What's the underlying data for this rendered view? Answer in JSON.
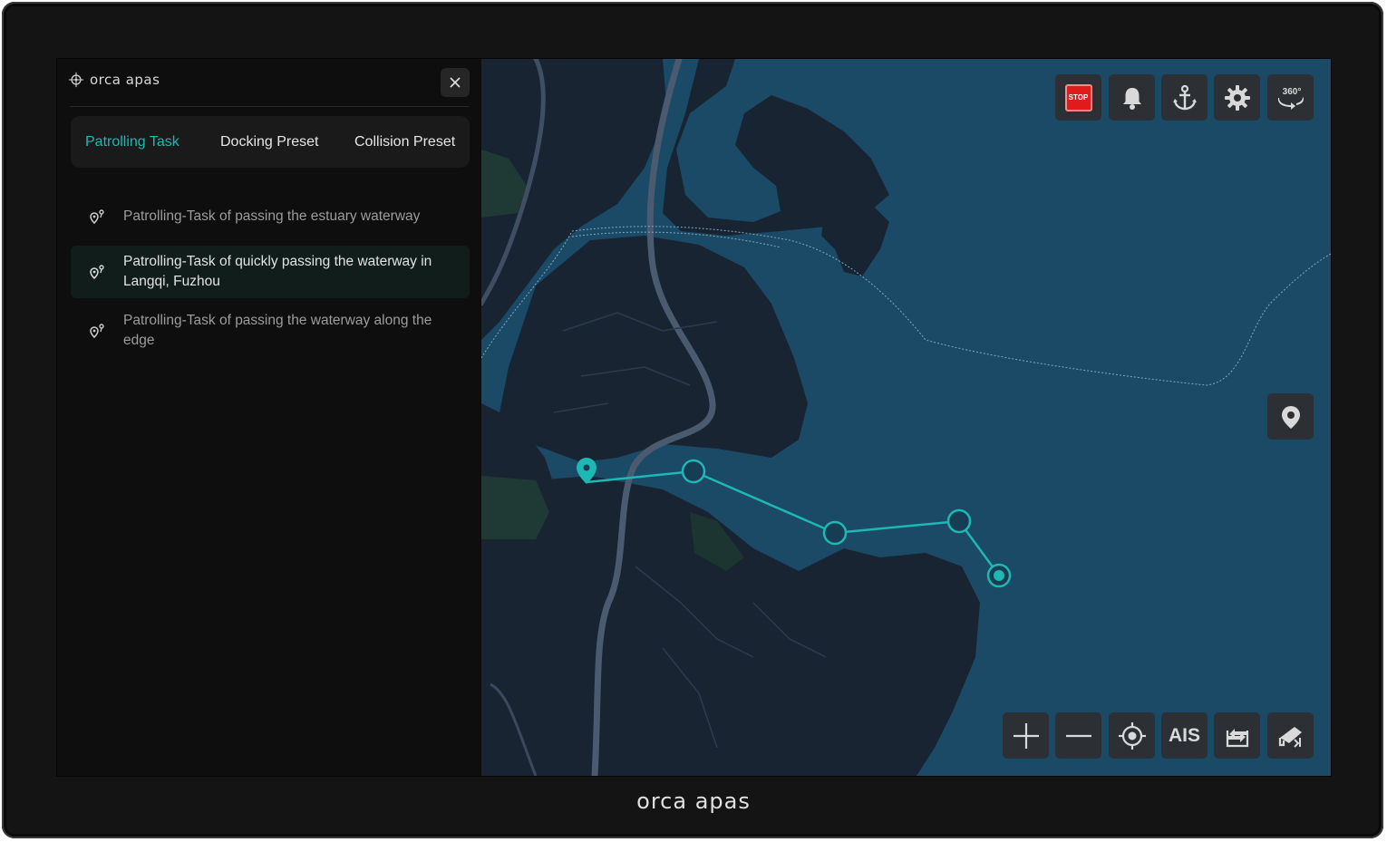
{
  "app": {
    "brand_small": "orca apas",
    "brand_footer": "orca apas"
  },
  "panel": {
    "close_icon": "close-icon",
    "tabs": [
      {
        "label": "Patrolling Task",
        "active": true
      },
      {
        "label": "Docking Preset",
        "active": false
      },
      {
        "label": "Collision Preset",
        "active": false
      }
    ],
    "tasks": [
      {
        "label": "Patrolling-Task of passing the estuary waterway",
        "selected": false,
        "icon": "route-pin-icon"
      },
      {
        "label": "Patrolling-Task of quickly passing the waterway in Langqi, Fuzhou",
        "selected": true,
        "icon": "route-pin-icon"
      },
      {
        "label": "Patrolling-Task of passing the waterway along the edge",
        "selected": false,
        "icon": "route-pin-icon"
      }
    ]
  },
  "map": {
    "top_controls": [
      {
        "name": "stop-button",
        "label": "STOP",
        "icon": "stop-icon"
      },
      {
        "name": "alarm-button",
        "icon": "bell-icon"
      },
      {
        "name": "anchor-button",
        "icon": "anchor-icon"
      },
      {
        "name": "settings-button",
        "icon": "gear-icon"
      },
      {
        "name": "view-360-button",
        "label": "360°",
        "icon": "rotate-360-icon"
      }
    ],
    "side_controls": [
      {
        "name": "location-pin-button",
        "icon": "map-pin-icon"
      }
    ],
    "bottom_controls": [
      {
        "name": "zoom-in-button",
        "icon": "plus-icon"
      },
      {
        "name": "zoom-out-button",
        "icon": "minus-icon"
      },
      {
        "name": "center-button",
        "icon": "crosshair-icon"
      },
      {
        "name": "ais-button",
        "label": "AIS"
      },
      {
        "name": "route-swap-button",
        "icon": "swap-icon"
      },
      {
        "name": "camera-button",
        "icon": "camera-icon"
      }
    ],
    "colors": {
      "water": "#1a4a66",
      "land": "#192433",
      "route": "#1fb7b4"
    }
  }
}
